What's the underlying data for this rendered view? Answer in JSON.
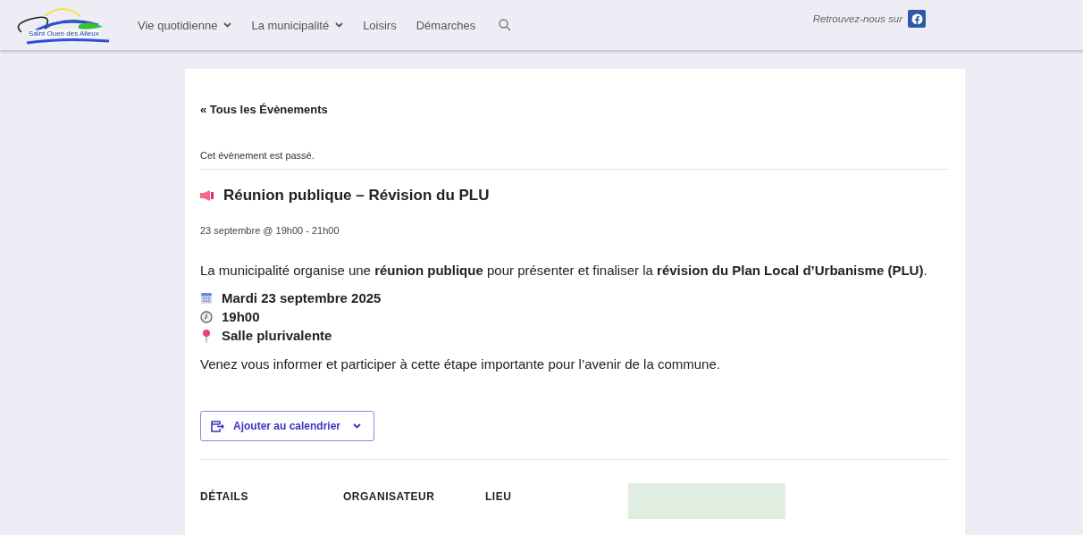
{
  "header": {
    "logo_text": "Saint Ouen des Alleux",
    "nav": [
      {
        "label": "Vie quotidienne",
        "dropdown": true
      },
      {
        "label": "La municipalité",
        "dropdown": true
      },
      {
        "label": "Loisirs",
        "dropdown": false
      },
      {
        "label": "Démarches",
        "dropdown": false
      }
    ],
    "social_label": "Retrouvez-nous sur"
  },
  "event": {
    "back_link": "« Tous les Évènements",
    "notice": "Cet évènement est passé.",
    "title": "Réunion publique – Révision du PLU",
    "schedule": "23 septembre @ 19h00 - 21h00",
    "intro": "La municipalité organise une **réunion publique** pour présenter et finaliser la **révision du Plan Local d’Urbanisme (PLU)**.",
    "facts": [
      {
        "kind": "calendar",
        "text": "Mardi 23 septembre 2025"
      },
      {
        "kind": "clock",
        "text": "19h00"
      },
      {
        "kind": "pin",
        "text": "Salle plurivalente"
      }
    ],
    "closing": "Venez vous informer et participer à cette étape importante pour l’avenir de la commune.",
    "calendar_button": "Ajouter au calendrier",
    "sections": [
      "DÉTAILS",
      "ORGANISATEUR",
      "LIEU"
    ]
  }
}
